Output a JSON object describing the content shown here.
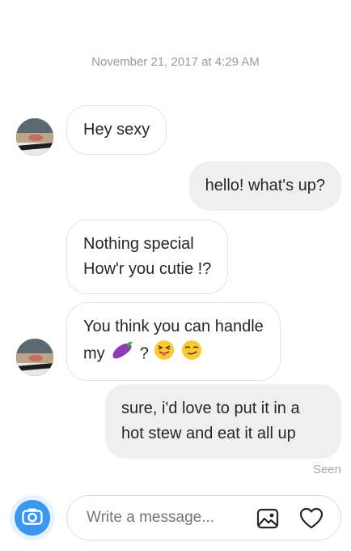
{
  "chat": {
    "timestamp": "November 21, 2017 at 4:29 AM",
    "messages": [
      {
        "from": "them",
        "lines": [
          "Hey sexy"
        ]
      },
      {
        "from": "me",
        "lines": [
          "hello! what's up?"
        ]
      },
      {
        "from": "them",
        "lines": [
          "Nothing special",
          "How'r you cutie !?"
        ]
      },
      {
        "from": "them",
        "line1": "You think you can handle",
        "line2_prefix": "my",
        "line2_mid": "?",
        "emojis": [
          "eggplant-emoji",
          "squinting-tongue-emoji",
          "smirk-emoji"
        ]
      },
      {
        "from": "me",
        "lines": [
          "sure, i'd love to put it in a",
          "hot stew and eat it all up"
        ]
      }
    ],
    "seen_label": "Seen"
  },
  "composer": {
    "placeholder": "Write a message...",
    "icons": [
      "camera-icon",
      "image-icon",
      "heart-icon"
    ]
  },
  "colors": {
    "accent": "#3897f0",
    "outgoing_bubble": "#efefef",
    "incoming_border": "#e3e3e3",
    "meta_text": "#999999"
  }
}
